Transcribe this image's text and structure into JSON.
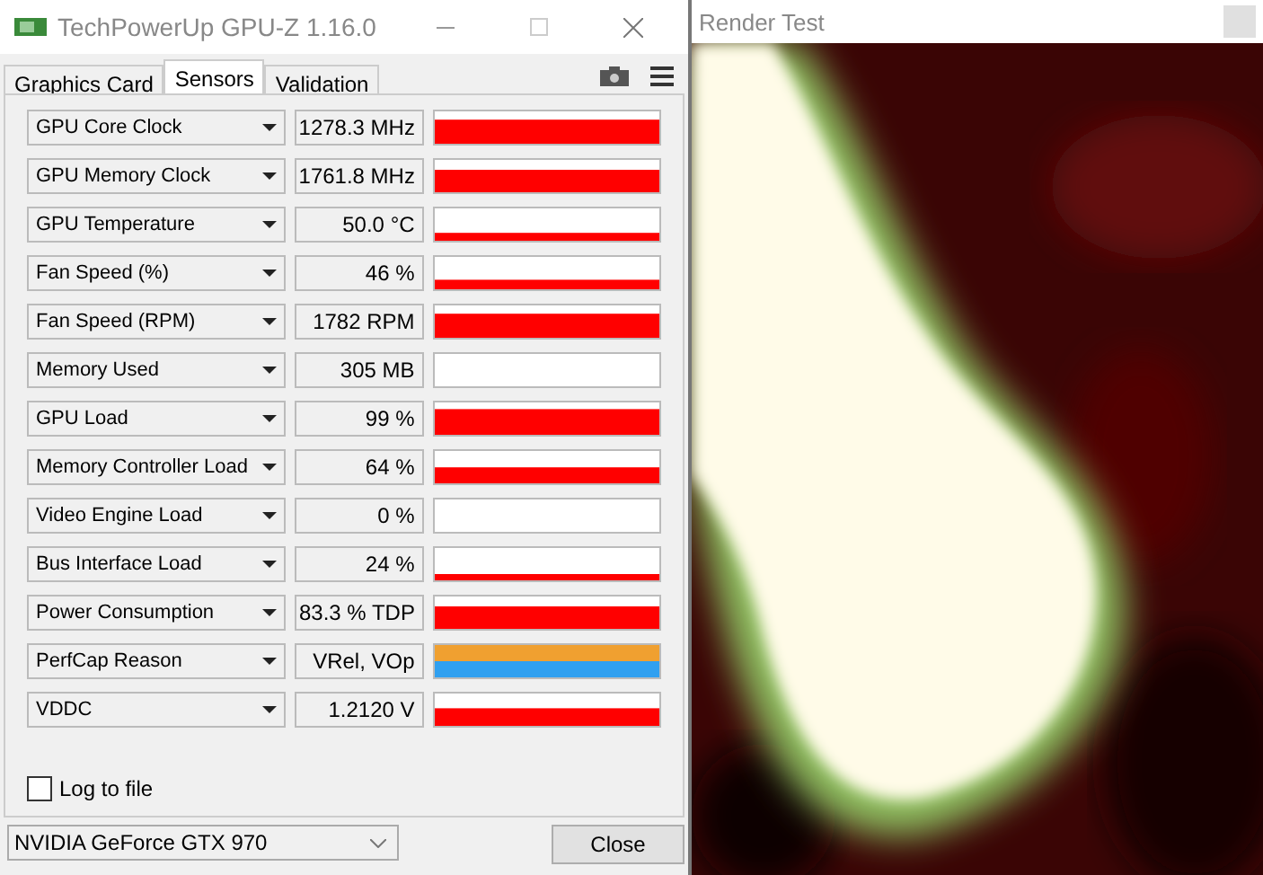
{
  "window": {
    "title": "TechPowerUp GPU-Z 1.16.0"
  },
  "tabs": [
    {
      "label": "Graphics Card",
      "selected": false
    },
    {
      "label": "Sensors",
      "selected": true
    },
    {
      "label": "Validation",
      "selected": false
    }
  ],
  "sensors": [
    {
      "name": "GPU Core Clock",
      "value": "1278.3 MHz",
      "kind": "graph"
    },
    {
      "name": "GPU Memory Clock",
      "value": "1761.8 MHz",
      "kind": "graph"
    },
    {
      "name": "GPU Temperature",
      "value": "50.0 °C",
      "kind": "graph"
    },
    {
      "name": "Fan Speed (%)",
      "value": "46 %",
      "kind": "graph"
    },
    {
      "name": "Fan Speed (RPM)",
      "value": "1782 RPM",
      "kind": "graph"
    },
    {
      "name": "Memory Used",
      "value": "305 MB",
      "kind": "graph"
    },
    {
      "name": "GPU Load",
      "value": "99 %",
      "kind": "graph"
    },
    {
      "name": "Memory Controller Load",
      "value": "64 %",
      "kind": "graph"
    },
    {
      "name": "Video Engine Load",
      "value": "0 %",
      "kind": "graph"
    },
    {
      "name": "Bus Interface Load",
      "value": "24 %",
      "kind": "graph"
    },
    {
      "name": "Power Consumption",
      "value": "83.3 % TDP",
      "kind": "graph"
    },
    {
      "name": "PerfCap Reason",
      "value": "VRel, VOp",
      "kind": "perfcap",
      "segments": [
        {
          "color": "#f0a030"
        },
        {
          "color": "#30a0f0"
        }
      ]
    },
    {
      "name": "VDDC",
      "value": "1.2120 V",
      "kind": "graph"
    }
  ],
  "log_to_file": {
    "label": "Log to file",
    "checked": false
  },
  "gpu_select": {
    "value": "NVIDIA GeForce GTX 970"
  },
  "close_button": "Close",
  "render_window": {
    "title": "Render Test"
  }
}
